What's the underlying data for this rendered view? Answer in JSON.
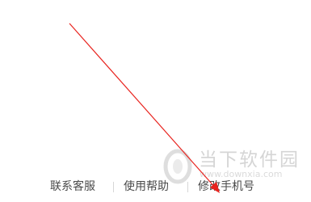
{
  "footer": {
    "links": [
      {
        "label": "联系客服"
      },
      {
        "label": "使用帮助"
      },
      {
        "label": "修改手机号"
      }
    ]
  },
  "watermark": {
    "name": "当下软件园",
    "url": "www.downxia.com"
  },
  "annotation": {
    "type": "arrow",
    "color": "#e8231e",
    "icon": "red-arrow-icon"
  }
}
